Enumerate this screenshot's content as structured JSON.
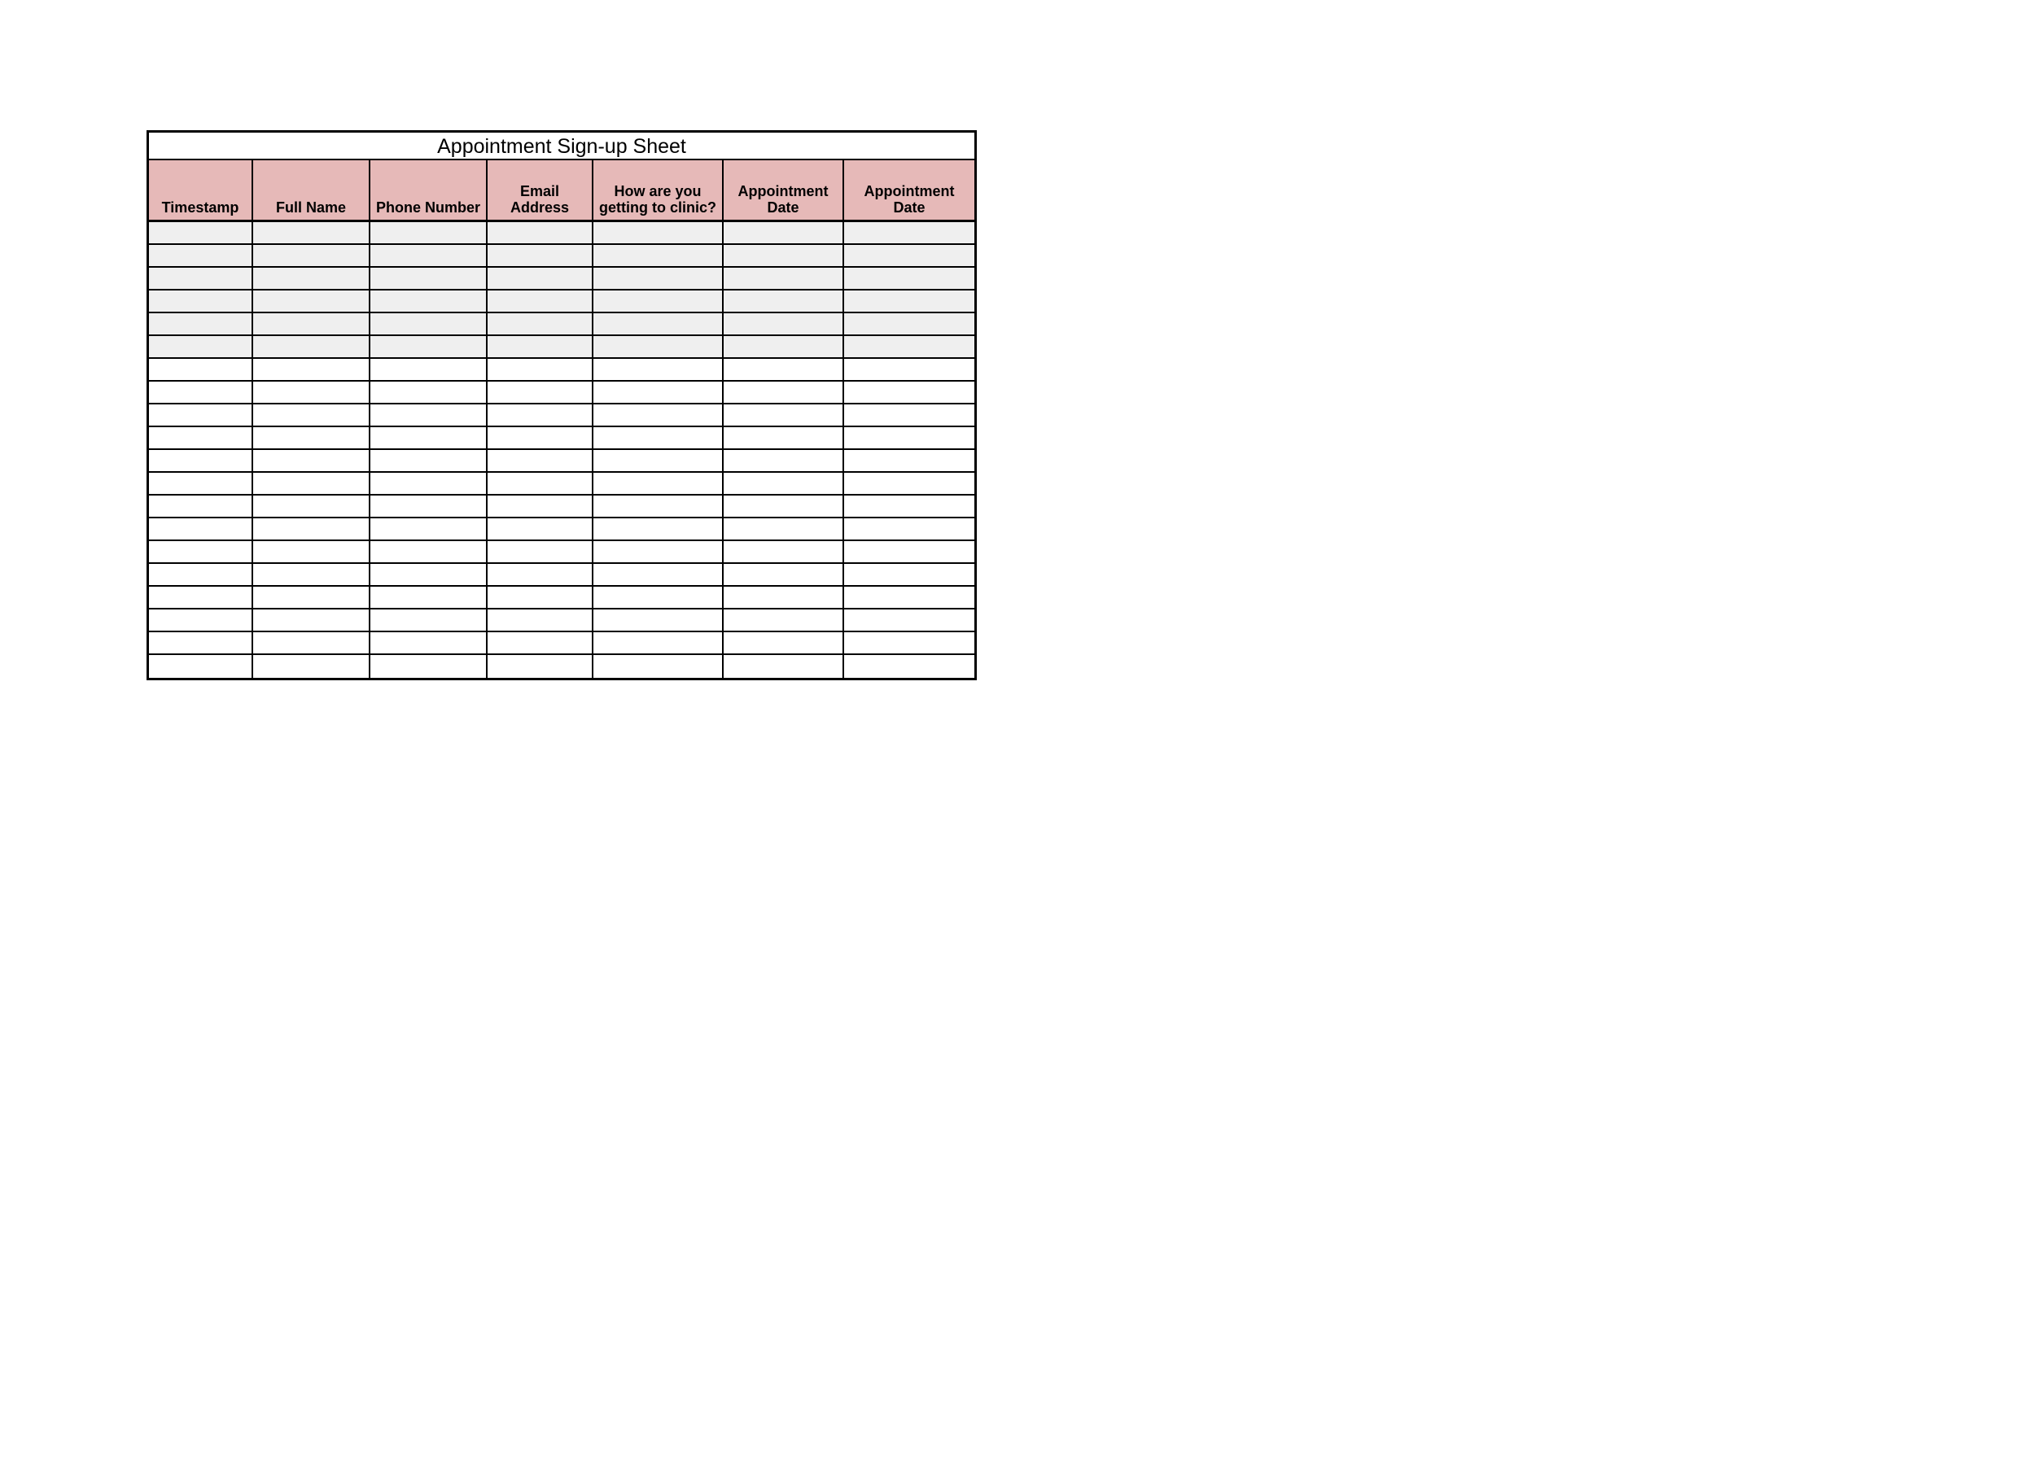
{
  "title": "Appointment Sign-up Sheet",
  "columns": [
    "Timestamp",
    "Full Name",
    "Phone Number",
    "Email Address",
    "How are you getting to clinic?",
    "Appointment Date",
    "Appointment Date"
  ],
  "rows": [
    {
      "shaded": true,
      "cells": [
        "",
        "",
        "",
        "",
        "",
        "",
        ""
      ]
    },
    {
      "shaded": true,
      "cells": [
        "",
        "",
        "",
        "",
        "",
        "",
        ""
      ]
    },
    {
      "shaded": true,
      "cells": [
        "",
        "",
        "",
        "",
        "",
        "",
        ""
      ]
    },
    {
      "shaded": true,
      "cells": [
        "",
        "",
        "",
        "",
        "",
        "",
        ""
      ]
    },
    {
      "shaded": true,
      "cells": [
        "",
        "",
        "",
        "",
        "",
        "",
        ""
      ]
    },
    {
      "shaded": true,
      "cells": [
        "",
        "",
        "",
        "",
        "",
        "",
        ""
      ]
    },
    {
      "shaded": false,
      "cells": [
        "",
        "",
        "",
        "",
        "",
        "",
        ""
      ]
    },
    {
      "shaded": false,
      "cells": [
        "",
        "",
        "",
        "",
        "",
        "",
        ""
      ]
    },
    {
      "shaded": false,
      "cells": [
        "",
        "",
        "",
        "",
        "",
        "",
        ""
      ]
    },
    {
      "shaded": false,
      "cells": [
        "",
        "",
        "",
        "",
        "",
        "",
        ""
      ]
    },
    {
      "shaded": false,
      "cells": [
        "",
        "",
        "",
        "",
        "",
        "",
        ""
      ]
    },
    {
      "shaded": false,
      "cells": [
        "",
        "",
        "",
        "",
        "",
        "",
        ""
      ]
    },
    {
      "shaded": false,
      "cells": [
        "",
        "",
        "",
        "",
        "",
        "",
        ""
      ]
    },
    {
      "shaded": false,
      "cells": [
        "",
        "",
        "",
        "",
        "",
        "",
        ""
      ]
    },
    {
      "shaded": false,
      "cells": [
        "",
        "",
        "",
        "",
        "",
        "",
        ""
      ]
    },
    {
      "shaded": false,
      "cells": [
        "",
        "",
        "",
        "",
        "",
        "",
        ""
      ]
    },
    {
      "shaded": false,
      "cells": [
        "",
        "",
        "",
        "",
        "",
        "",
        ""
      ]
    },
    {
      "shaded": false,
      "cells": [
        "",
        "",
        "",
        "",
        "",
        "",
        ""
      ]
    },
    {
      "shaded": false,
      "cells": [
        "",
        "",
        "",
        "",
        "",
        "",
        ""
      ]
    },
    {
      "shaded": false,
      "cells": [
        "",
        "",
        "",
        "",
        "",
        "",
        ""
      ]
    }
  ],
  "colors": {
    "header_bg": "#e6b9b8",
    "shaded_bg": "#efefef"
  }
}
